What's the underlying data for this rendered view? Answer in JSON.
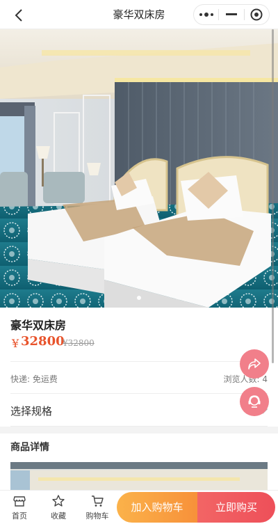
{
  "navbar": {
    "title": "豪华双床房",
    "back_icon": "chevron-left-icon",
    "more_icon": "more-dots-icon",
    "minimize_icon": "minimize-icon",
    "close_icon": "target-close-icon"
  },
  "hero": {
    "image": "hotel-twin-room-photo",
    "slide_index": 1,
    "slide_count": 1
  },
  "product": {
    "title": "豪华双床房",
    "currency": "¥",
    "price": "32800",
    "original_price": "¥32800",
    "shipping": "快递: 免运费",
    "views": "浏览人数: 4"
  },
  "spec": {
    "label": "选择规格",
    "chevron_icon": "chevron-right-icon"
  },
  "detail": {
    "title": "商品详情",
    "image": "hotel-room-detail-photo"
  },
  "floating": {
    "share_icon": "share-arrow-icon",
    "service_icon": "customer-service-icon"
  },
  "bottom_bar": {
    "tabs": [
      {
        "label": "首页",
        "icon": "shop-icon"
      },
      {
        "label": "收藏",
        "icon": "star-icon"
      },
      {
        "label": "购物车",
        "icon": "cart-icon"
      }
    ],
    "add_to_cart": "加入购物车",
    "buy_now": "立即购买"
  },
  "colors": {
    "price": "#e8532b",
    "cart_button": "#f7913a",
    "buy_button": "#ee4f59",
    "floating": "#f17f8a"
  }
}
